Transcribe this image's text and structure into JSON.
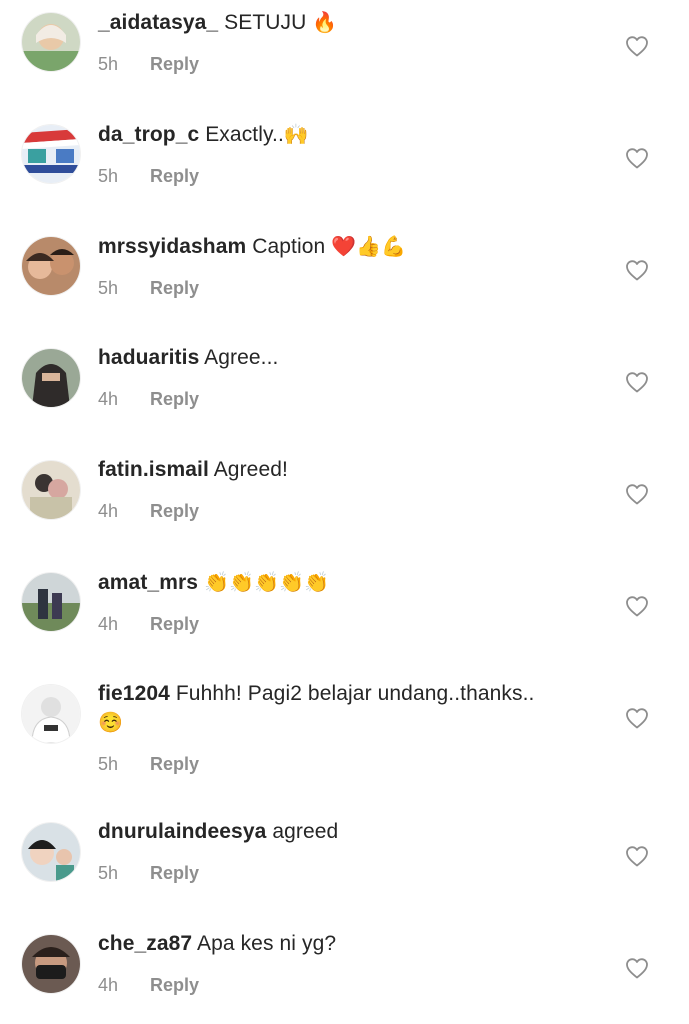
{
  "comments": [
    {
      "username": "_aidatasya_",
      "text": "SETUJU",
      "emoji": "🔥",
      "time": "5h",
      "reply": "Reply"
    },
    {
      "username": "da_trop_c",
      "text": "Exactly..",
      "emoji": "🙌",
      "time": "5h",
      "reply": "Reply"
    },
    {
      "username": "mrssyidasham",
      "text": "Caption",
      "emoji": "❤️👍💪",
      "time": "5h",
      "reply": "Reply"
    },
    {
      "username": "haduaritis",
      "text": "Agree...",
      "emoji": "",
      "time": "4h",
      "reply": "Reply"
    },
    {
      "username": "fatin.ismail",
      "text": "Agreed!",
      "emoji": "",
      "time": "4h",
      "reply": "Reply"
    },
    {
      "username": "amat_mrs",
      "text": "",
      "emoji": "👏👏👏👏👏",
      "time": "4h",
      "reply": "Reply"
    },
    {
      "username": "fie1204",
      "text": "Fuhhh! Pagi2 belajar undang..thanks..",
      "emoji": "☺️",
      "time": "5h",
      "reply": "Reply"
    },
    {
      "username": "dnurulaindeesya",
      "text": "agreed",
      "emoji": "",
      "time": "5h",
      "reply": "Reply"
    },
    {
      "username": "che_za87",
      "text": "Apa kes ni yg?",
      "emoji": "",
      "time": "4h",
      "reply": "Reply"
    }
  ],
  "colors": {
    "text": "#262626",
    "secondary": "#8e8e8e",
    "heart_outline": "#8e8e8e"
  },
  "icons": {
    "like": "heart-outline-icon"
  }
}
